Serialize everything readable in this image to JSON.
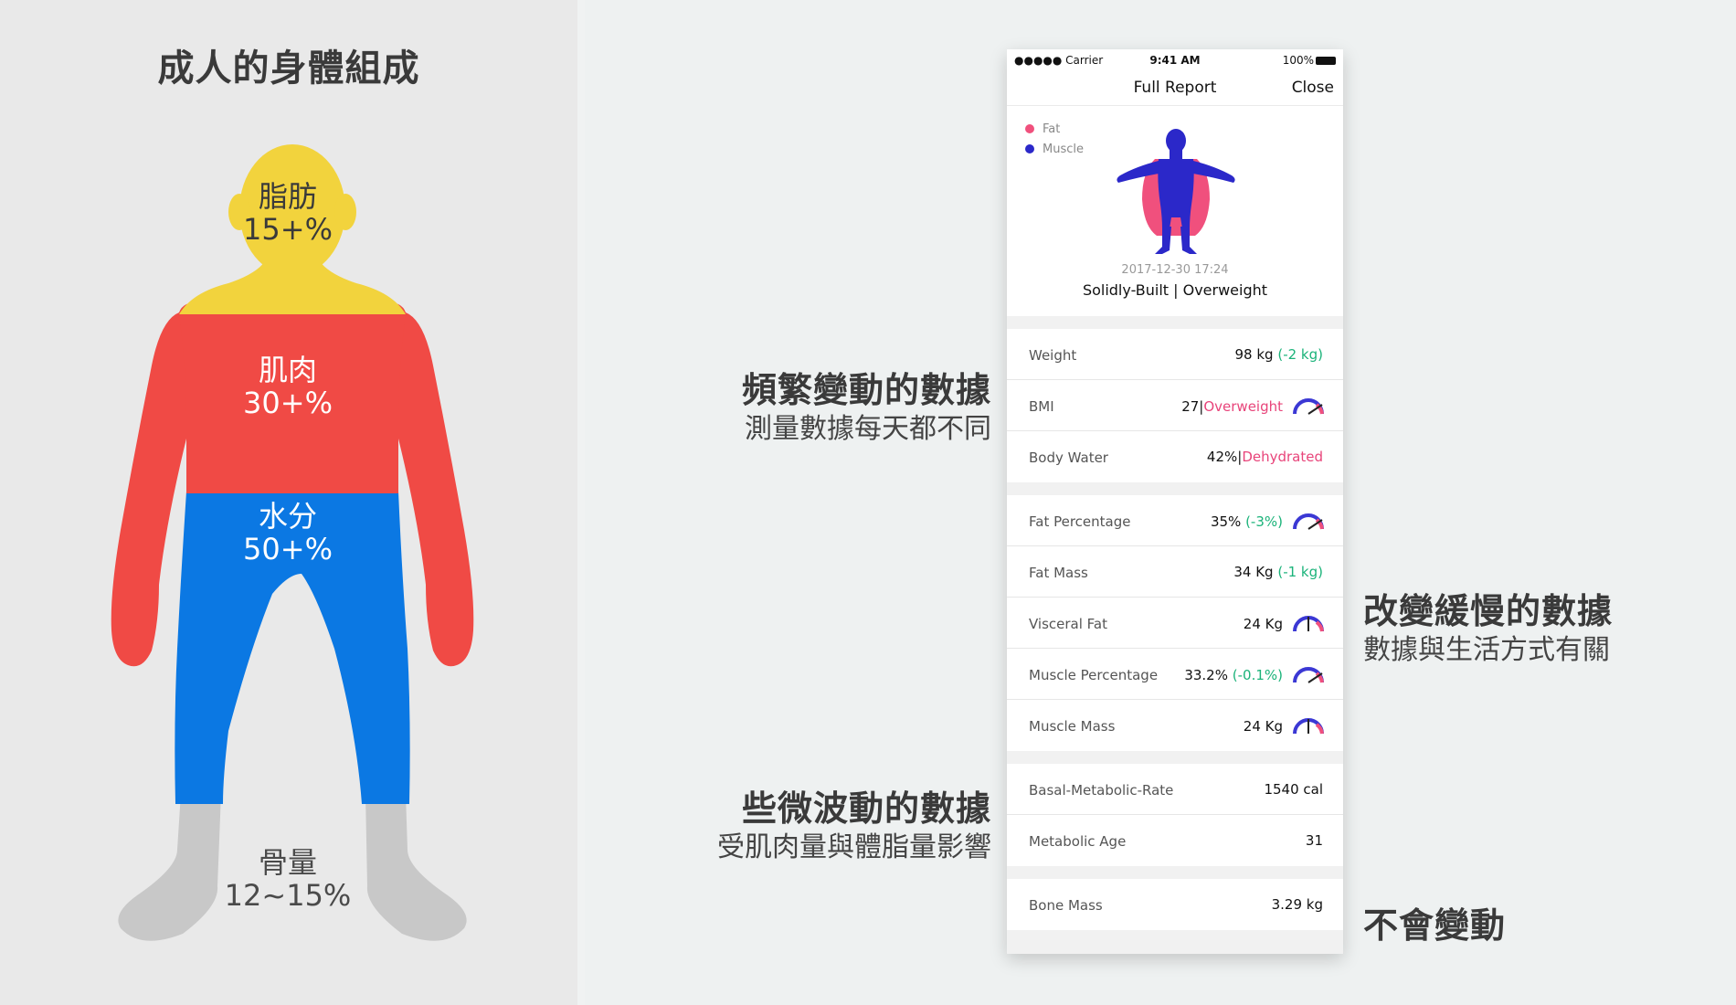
{
  "left": {
    "title": "成人的身體組成",
    "fat": {
      "name": "脂肪",
      "value": "15+%"
    },
    "muscle": {
      "name": "肌肉",
      "value": "30+%"
    },
    "water": {
      "name": "水分",
      "value": "50+%"
    },
    "bone": {
      "name": "骨量",
      "value": "12~15%"
    },
    "colors": {
      "fat": "#f2d33d",
      "muscle": "#f04a45",
      "water": "#0b78e3",
      "bone": "#c8c8c8"
    }
  },
  "annotations": {
    "frequent": {
      "title": "頻繁變動的數據",
      "sub": "測量數據每天都不同"
    },
    "slight": {
      "title": "些微波動的數據",
      "sub": "受肌肉量與體脂量影響"
    },
    "slow": {
      "title": "改變緩慢的數據",
      "sub": "數據與生活方式有關"
    },
    "none": {
      "title": "不會變動"
    }
  },
  "phone": {
    "status": {
      "carrier": "●●●●● Carrier",
      "time": "9:41 AM",
      "battery": "100%"
    },
    "nav": {
      "title": "Full Report",
      "close": "Close"
    },
    "legend": {
      "fat": "Fat",
      "muscle": "Muscle",
      "fat_color": "#f0507d",
      "muscle_color": "#2b28c9"
    },
    "timestamp": "2017-12-30  17:24",
    "body_type": "Solidly-Built | Overweight",
    "weight": {
      "label": "Weight",
      "value": "98 kg",
      "delta": "(-2 kg)"
    },
    "bmi": {
      "label": "BMI",
      "value": "27",
      "sep": " | ",
      "status": "Overweight"
    },
    "water": {
      "label": "Body Water",
      "value": "42%",
      "sep": " | ",
      "status": "Dehydrated"
    },
    "fat_pct": {
      "label": "Fat Percentage",
      "value": "35%",
      "delta": "(-3%)"
    },
    "fat_mass": {
      "label": "Fat Mass",
      "value": "34 Kg",
      "delta": "(-1 kg)"
    },
    "visceral": {
      "label": "Visceral Fat",
      "value": "24 Kg"
    },
    "muscle_pct": {
      "label": "Muscle Percentage",
      "value": "33.2%",
      "delta": "(-0.1%)"
    },
    "muscle_mass": {
      "label": "Muscle Mass",
      "value": "24 Kg"
    },
    "bmr": {
      "label": "Basal-Metabolic-Rate",
      "value": "1540 cal"
    },
    "meta_age": {
      "label": "Metabolic Age",
      "value": "31"
    },
    "bone_mass": {
      "label": "Bone Mass",
      "value": "3.29 kg"
    }
  }
}
